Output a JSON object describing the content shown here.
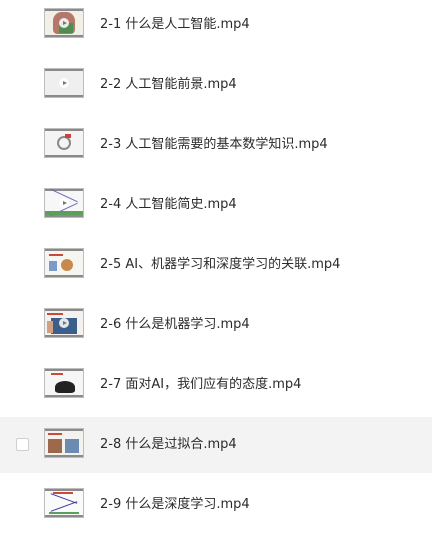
{
  "files": [
    {
      "name": "2-1 什么是人工智能.mp4",
      "thumbnail_icon": "video-thumbnail-icon"
    },
    {
      "name": "2-2 人工智能前景.mp4",
      "thumbnail_icon": "video-thumbnail-icon"
    },
    {
      "name": "2-3 人工智能需要的基本数学知识.mp4",
      "thumbnail_icon": "video-thumbnail-icon"
    },
    {
      "name": "2-4 人工智能简史.mp4",
      "thumbnail_icon": "video-thumbnail-icon"
    },
    {
      "name": "2-5 AI、机器学习和深度学习的关联.mp4",
      "thumbnail_icon": "video-thumbnail-icon"
    },
    {
      "name": "2-6 什么是机器学习.mp4",
      "thumbnail_icon": "video-thumbnail-icon"
    },
    {
      "name": "2-7 面对AI，我们应有的态度.mp4",
      "thumbnail_icon": "video-thumbnail-icon"
    },
    {
      "name": "2-8 什么是过拟合.mp4",
      "thumbnail_icon": "video-thumbnail-icon",
      "hovered": true,
      "checked": false
    },
    {
      "name": "2-9 什么是深度学习.mp4",
      "thumbnail_icon": "video-thumbnail-icon"
    }
  ],
  "colors": {
    "hover_background": "#f3f3f3",
    "text": "#2b2b2b"
  }
}
